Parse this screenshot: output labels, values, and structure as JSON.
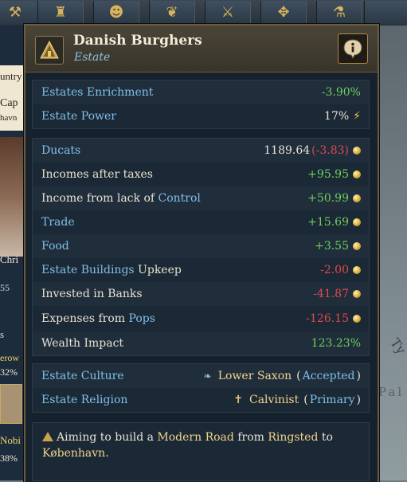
{
  "toolbar": {
    "icons": [
      "tools-icon",
      "castle-icon",
      "advisors-icon",
      "dove-icon",
      "crossed-swords-icon",
      "compass-icon",
      "flask-icon"
    ]
  },
  "background": {
    "left_fragments": [
      "untry",
      "Cap",
      "havn",
      "Chri",
      "55",
      "s",
      "erow",
      "32%",
      "Nobi",
      "38%"
    ],
    "map_labels": [
      "Ty",
      "Pal"
    ]
  },
  "tooltip": {
    "title": "Danish Burghers",
    "subtitle": "Estate",
    "section1": [
      {
        "label": "Estates Enrichment",
        "value": "-3.90%",
        "value_color": "green"
      },
      {
        "label": "Estate Power",
        "value": "17%",
        "icon": "lightning-icon"
      }
    ],
    "finance": {
      "ducats_label": "Ducats",
      "ducats_value": "1189.64",
      "ducats_change": "(-3.83)",
      "rows": [
        {
          "label": "Incomes after taxes",
          "value": "+95.95",
          "color": "green",
          "coin": true
        },
        {
          "label_plain": "Income from lack of ",
          "label_link": "Control",
          "value": "+50.99",
          "color": "green",
          "coin": true
        },
        {
          "label_link": "Trade",
          "value": "+15.69",
          "color": "green",
          "coin": true
        },
        {
          "label_link": "Food",
          "value": "+3.55",
          "color": "green",
          "coin": true
        },
        {
          "label_link": "Estate Buildings",
          "label_plain": " Upkeep",
          "value": "-2.00",
          "color": "red",
          "coin": true
        },
        {
          "label": "Invested in Banks",
          "value": "-41.87",
          "color": "red",
          "coin": true
        },
        {
          "label_plain": "Expenses from ",
          "label_link": "Pops",
          "value": "-126.15",
          "color": "red",
          "coin": true
        },
        {
          "label": "Wealth Impact",
          "value": "123.23%",
          "color": "green"
        }
      ]
    },
    "culture": {
      "culture_label": "Estate Culture",
      "culture_value": "Lower Saxon",
      "culture_status": "Accepted",
      "religion_label": "Estate Religion",
      "religion_value": "Calvinist",
      "religion_status": "Primary"
    },
    "note": {
      "prefix": "Aiming to build a ",
      "building": "Modern Road",
      "middle": " from ",
      "origin": "Ringsted",
      "to": " to",
      "destination": "København",
      "end": "."
    }
  },
  "colors": {
    "green": "#6ed05b",
    "red": "#e0484d",
    "blue_link": "#7fc0e8",
    "gold_text": "#f2d48c",
    "panel": "#15212d"
  }
}
